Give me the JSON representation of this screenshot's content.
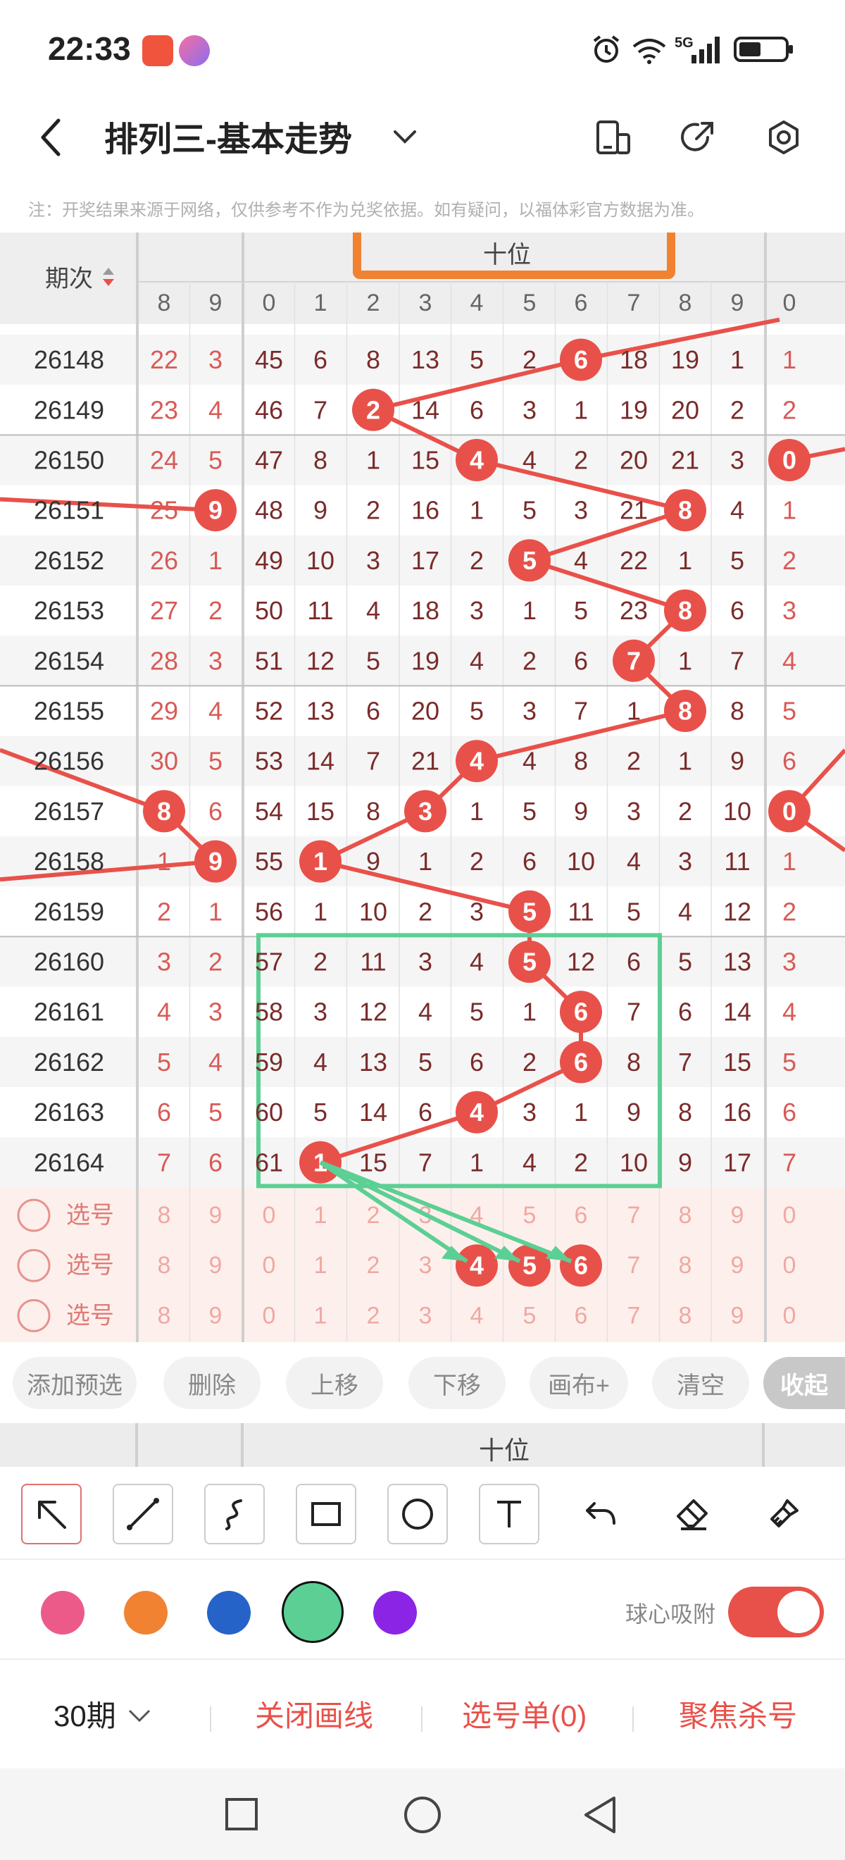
{
  "status": {
    "time": "22:33",
    "network": "5G"
  },
  "header": {
    "title": "排列三-基本走势"
  },
  "notice": "注：开奖结果来源于网络，仅供参考不作为兑奖依据。如有疑问，以福体彩官方数据为准。",
  "table": {
    "period_label": "期次",
    "section_label": "十位",
    "cols": [
      "8",
      "9",
      "0",
      "1",
      "2",
      "3",
      "4",
      "5",
      "6",
      "7",
      "8",
      "9",
      "0"
    ],
    "rows": [
      {
        "p": "26148",
        "v": [
          "22",
          "3",
          "45",
          "6",
          "8",
          "13",
          "5",
          "2",
          "6",
          "18",
          "19",
          "1",
          "1"
        ]
      },
      {
        "p": "26149",
        "v": [
          "23",
          "4",
          "46",
          "7",
          "2",
          "14",
          "6",
          "3",
          "1",
          "19",
          "20",
          "2",
          "2"
        ]
      },
      {
        "p": "26150",
        "v": [
          "24",
          "5",
          "47",
          "8",
          "1",
          "15",
          "4",
          "4",
          "2",
          "20",
          "21",
          "3",
          "0"
        ]
      },
      {
        "p": "26151",
        "v": [
          "25",
          "9",
          "48",
          "9",
          "2",
          "16",
          "1",
          "5",
          "3",
          "21",
          "8",
          "4",
          "1"
        ]
      },
      {
        "p": "26152",
        "v": [
          "26",
          "1",
          "49",
          "10",
          "3",
          "17",
          "2",
          "5",
          "4",
          "22",
          "1",
          "5",
          "2"
        ]
      },
      {
        "p": "26153",
        "v": [
          "27",
          "2",
          "50",
          "11",
          "4",
          "18",
          "3",
          "1",
          "5",
          "23",
          "8",
          "6",
          "3"
        ]
      },
      {
        "p": "26154",
        "v": [
          "28",
          "3",
          "51",
          "12",
          "5",
          "19",
          "4",
          "2",
          "6",
          "7",
          "1",
          "7",
          "4"
        ]
      },
      {
        "p": "26155",
        "v": [
          "29",
          "4",
          "52",
          "13",
          "6",
          "20",
          "5",
          "3",
          "7",
          "1",
          "8",
          "8",
          "5"
        ]
      },
      {
        "p": "26156",
        "v": [
          "30",
          "5",
          "53",
          "14",
          "7",
          "21",
          "4",
          "4",
          "8",
          "2",
          "1",
          "9",
          "6"
        ]
      },
      {
        "p": "26157",
        "v": [
          "8",
          "6",
          "54",
          "15",
          "8",
          "3",
          "1",
          "5",
          "9",
          "3",
          "2",
          "10",
          "0"
        ]
      },
      {
        "p": "26158",
        "v": [
          "1",
          "9",
          "55",
          "1",
          "9",
          "1",
          "2",
          "6",
          "10",
          "4",
          "3",
          "11",
          "1"
        ]
      },
      {
        "p": "26159",
        "v": [
          "2",
          "1",
          "56",
          "1",
          "10",
          "2",
          "3",
          "5",
          "11",
          "5",
          "4",
          "12",
          "2"
        ]
      },
      {
        "p": "26160",
        "v": [
          "3",
          "2",
          "57",
          "2",
          "11",
          "3",
          "4",
          "5",
          "12",
          "6",
          "5",
          "13",
          "3"
        ]
      },
      {
        "p": "26161",
        "v": [
          "4",
          "3",
          "58",
          "3",
          "12",
          "4",
          "5",
          "1",
          "6",
          "7",
          "6",
          "14",
          "4"
        ]
      },
      {
        "p": "26162",
        "v": [
          "5",
          "4",
          "59",
          "4",
          "13",
          "5",
          "6",
          "2",
          "6",
          "8",
          "7",
          "15",
          "5"
        ]
      },
      {
        "p": "26163",
        "v": [
          "6",
          "5",
          "60",
          "5",
          "14",
          "6",
          "4",
          "3",
          "1",
          "9",
          "8",
          "16",
          "6"
        ]
      },
      {
        "p": "26164",
        "v": [
          "7",
          "6",
          "61",
          "1",
          "15",
          "7",
          "1",
          "4",
          "2",
          "10",
          "9",
          "17",
          "7"
        ]
      }
    ],
    "select_label": "选号",
    "select_rows": [
      {
        "v": [
          "8",
          "9",
          "0",
          "1",
          "2",
          "3",
          "4",
          "5",
          "6",
          "7",
          "8",
          "9",
          "0"
        ]
      },
      {
        "v": [
          "8",
          "9",
          "0",
          "1",
          "2",
          "3",
          "4",
          "5",
          "6",
          "7",
          "8",
          "9",
          "0"
        ]
      },
      {
        "v": [
          "8",
          "9",
          "0",
          "1",
          "2",
          "3",
          "4",
          "5",
          "6",
          "7",
          "8",
          "9",
          "0"
        ]
      }
    ]
  },
  "chips": {
    "add": "添加预选",
    "delete": "删除",
    "up": "上移",
    "down": "下移",
    "canvas": "画布+",
    "clear": "清空",
    "collapse": "收起"
  },
  "band_label": "十位",
  "colors": {
    "pink": "#ec5a8a",
    "orange": "#f08232",
    "blue": "#2563c9",
    "green": "#5ccf94",
    "purple": "#8c24e6",
    "accent": "#e8514a"
  },
  "snap_label": "球心吸附",
  "bottom": {
    "period": "30期",
    "close_draw": "关闭画线",
    "selection": "选号单(0)",
    "focus": "聚焦杀号"
  }
}
